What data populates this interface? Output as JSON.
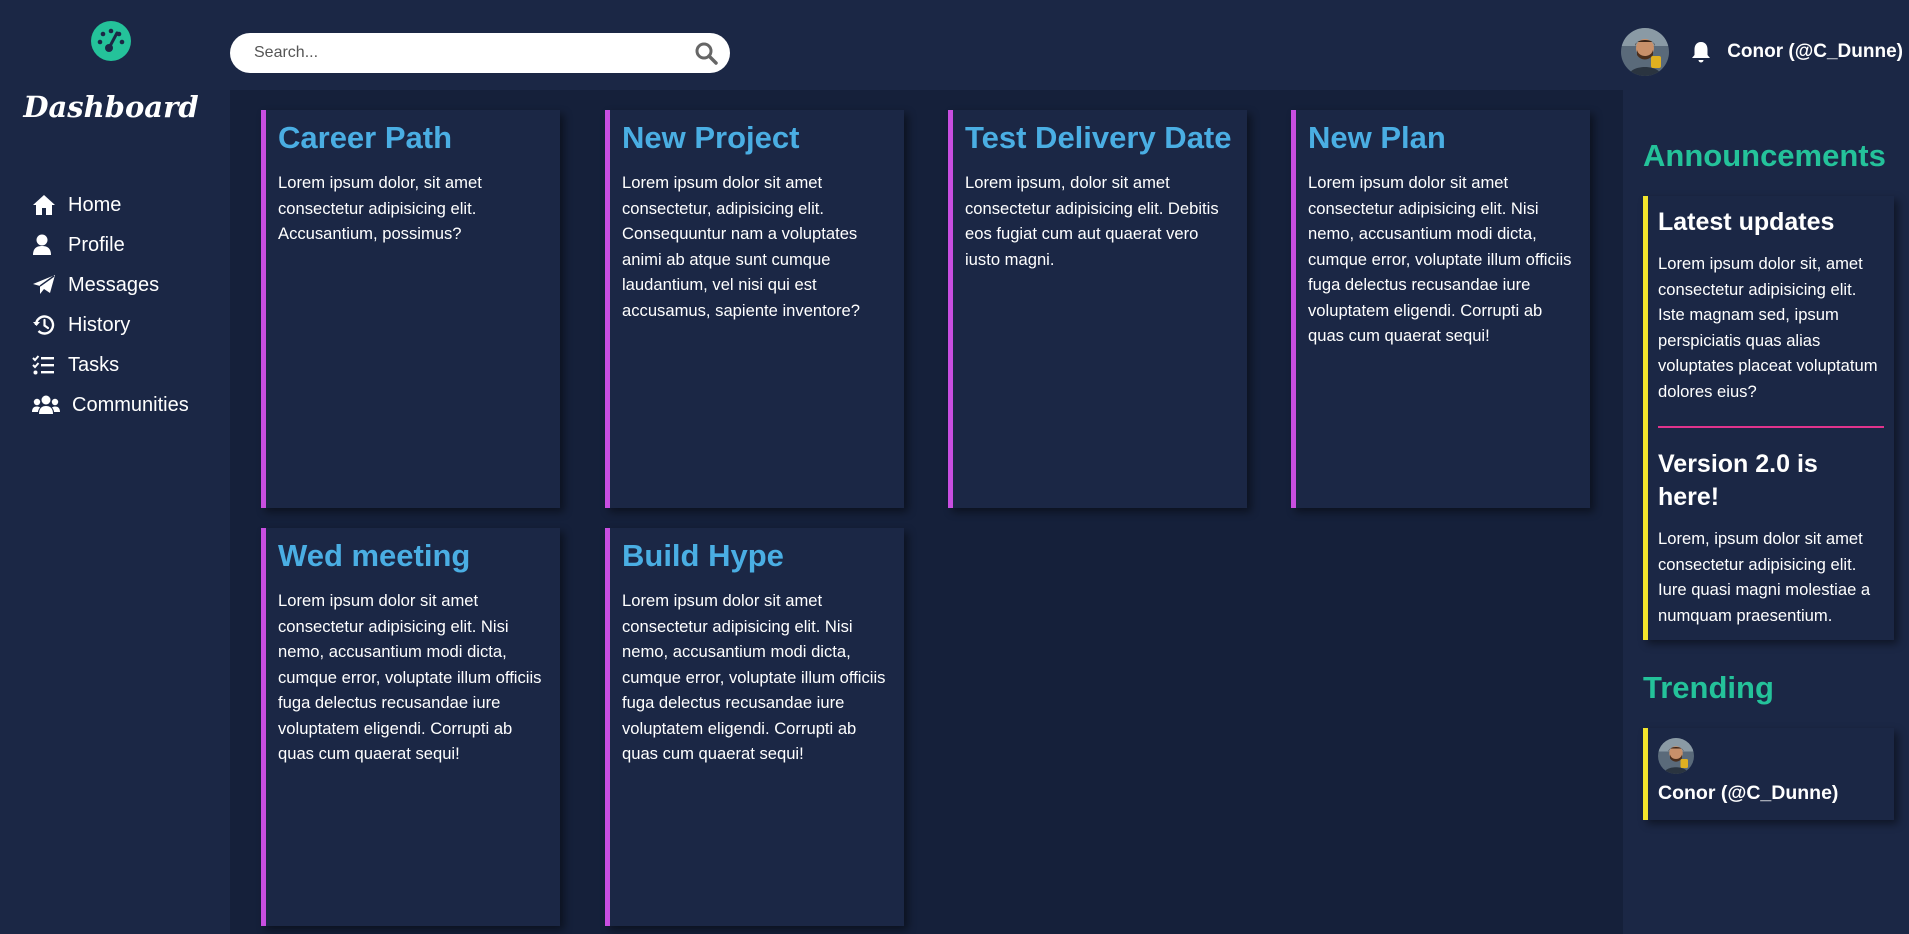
{
  "sidebar": {
    "brand": "Dashboard",
    "logo_icon": "dashboard-gauge-icon",
    "items": [
      {
        "label": "Home",
        "icon": "home-icon"
      },
      {
        "label": "Profile",
        "icon": "user-icon"
      },
      {
        "label": "Messages",
        "icon": "paper-plane-icon"
      },
      {
        "label": "History",
        "icon": "history-icon"
      },
      {
        "label": "Tasks",
        "icon": "tasks-icon"
      },
      {
        "label": "Communities",
        "icon": "users-icon"
      }
    ]
  },
  "header": {
    "search_placeholder": "Search...",
    "user_name": "Conor (@C_Dunne)"
  },
  "cards": [
    {
      "title": "Career Path",
      "body": "Lorem ipsum dolor, sit amet consectetur adipisicing elit. Accusantium, possimus?"
    },
    {
      "title": "New Project",
      "body": "Lorem ipsum dolor sit amet consectetur, adipisicing elit. Consequuntur nam a voluptates animi ab atque sunt cumque laudantium, vel nisi qui est accusamus, sapiente inventore?"
    },
    {
      "title": "Test Delivery Date",
      "body": "Lorem ipsum, dolor sit amet consectetur adipisicing elit. Debitis eos fugiat cum aut quaerat vero iusto magni."
    },
    {
      "title": "New Plan",
      "body": "Lorem ipsum dolor sit amet consectetur adipisicing elit. Nisi nemo, accusantium modi dicta, cumque error, voluptate illum officiis fuga delectus recusandae iure voluptatem eligendi. Corrupti ab quas cum quaerat sequi!"
    },
    {
      "title": "Wed meeting",
      "body": "Lorem ipsum dolor sit amet consectetur adipisicing elit. Nisi nemo, accusantium modi dicta, cumque error, voluptate illum officiis fuga delectus recusandae iure voluptatem eligendi. Corrupti ab quas cum quaerat sequi!"
    },
    {
      "title": "Build Hype",
      "body": "Lorem ipsum dolor sit amet consectetur adipisicing elit. Nisi nemo, accusantium modi dicta, cumque error, voluptate illum officiis fuga delectus recusandae iure voluptatem eligendi. Corrupti ab quas cum quaerat sequi!"
    }
  ],
  "announcements": {
    "title": "Announcements",
    "items": [
      {
        "title": "Latest updates",
        "body": "Lorem ipsum dolor sit, amet consectetur adipisicing elit. Iste magnam sed, ipsum perspiciatis quas alias voluptates placeat voluptatum dolores eius?"
      },
      {
        "title": "Version 2.0 is here!",
        "body": "Lorem, ipsum dolor sit amet consectetur adipisicing elit. Iure quasi magni molestiae a numquam praesentium."
      }
    ]
  },
  "trending": {
    "title": "Trending",
    "user_name": "Conor (@C_Dunne)"
  },
  "colors": {
    "background": "#1b2745",
    "main_background": "#15203a",
    "card_accent": "#c84ee0",
    "card_title": "#4aaee3",
    "section_title": "#24c29a",
    "announce_accent": "#f2e42c",
    "divider": "#e0338c"
  }
}
